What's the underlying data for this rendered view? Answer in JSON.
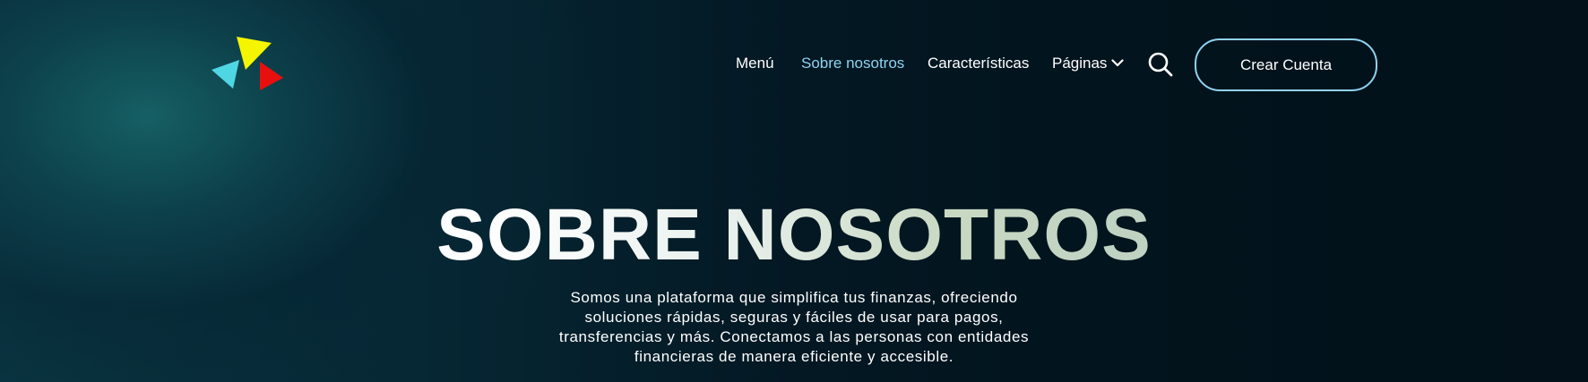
{
  "brand": {
    "logo_icon": "triangles-logo-icon",
    "colors": {
      "yellow": "#f5f500",
      "cyan": "#4fd6e3",
      "red": "#e80f0f"
    }
  },
  "nav": {
    "items": [
      {
        "label": "Menú",
        "active": false
      },
      {
        "label": "Sobre nosotros",
        "active": true
      },
      {
        "label": "Características",
        "active": false
      },
      {
        "label": "Páginas",
        "active": false,
        "icon": "chevron-down-icon"
      }
    ],
    "search_icon": "search-icon",
    "cta_label": "Crear Cuenta"
  },
  "hero": {
    "title": "SOBRE NOSOTROS",
    "description": "Somos una plataforma que simplifica tus finanzas, ofreciendo soluciones rápidas, seguras y fáciles de usar para pagos, transferencias y más. Conectamos a las personas con entidades financieras de manera eficiente y accesible."
  },
  "theme": {
    "accent": "#8fd3f0",
    "background_dark": "#02111a",
    "background_teal": "#166266"
  }
}
